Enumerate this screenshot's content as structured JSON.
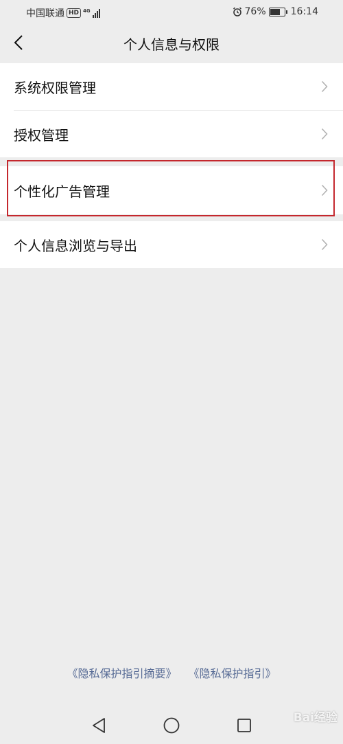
{
  "status_bar": {
    "carrier": "中国联通",
    "hd": "HD",
    "network": "4G",
    "battery": "76%",
    "battery_level": 0.76,
    "time": "16:14"
  },
  "header": {
    "title": "个人信息与权限"
  },
  "menu": {
    "group1": [
      {
        "label": "系统权限管理"
      },
      {
        "label": "授权管理"
      }
    ],
    "group2": [
      {
        "label": "个性化广告管理"
      }
    ],
    "group3": [
      {
        "label": "个人信息浏览与导出"
      }
    ]
  },
  "footer": {
    "link1": "《隐私保护指引摘要》",
    "link2": "《隐私保护指引》"
  },
  "watermark": "Bai经验",
  "colors": {
    "background": "#ededed",
    "link": "#576b95",
    "highlight": "#c4272d"
  }
}
